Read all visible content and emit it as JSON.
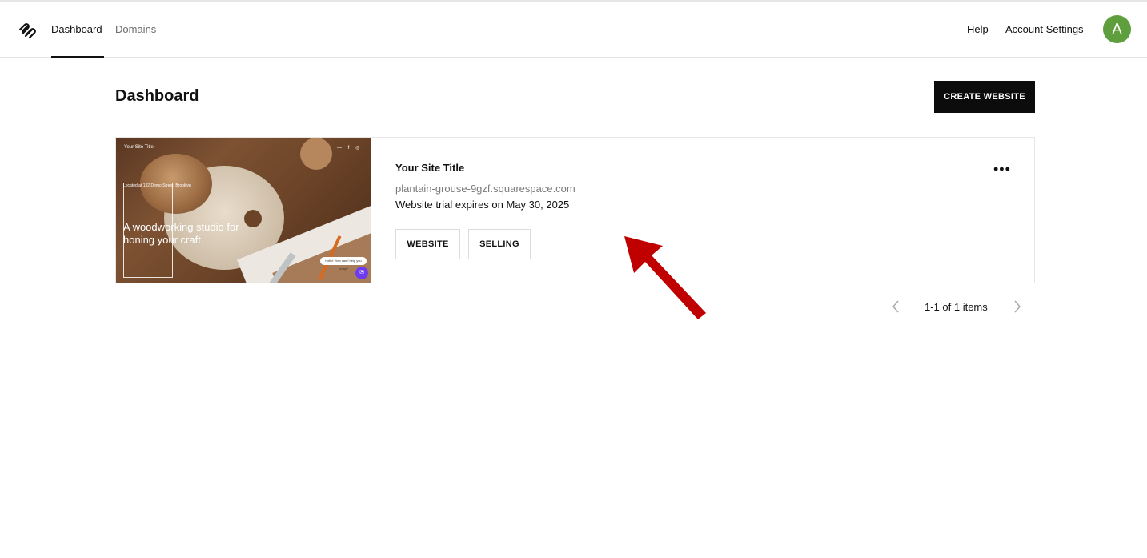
{
  "header": {
    "nav": [
      {
        "label": "Dashboard",
        "active": true
      },
      {
        "label": "Domains",
        "active": false
      }
    ],
    "help_label": "Help",
    "account_settings_label": "Account Settings",
    "avatar_initial": "A",
    "avatar_color": "#5e9e3c"
  },
  "page": {
    "title": "Dashboard",
    "create_button_label": "CREATE WEBSITE"
  },
  "site_card": {
    "thumbnail": {
      "site_title": "Your Site Title",
      "address": "Located at 132 Demo Street, Brooklyn",
      "headline": "A woodworking studio for honing your craft.",
      "chat_bubble": "Hello! How can I help you today?"
    },
    "title": "Your Site Title",
    "url": "plantain-grouse-9gzf.squarespace.com",
    "trial_status": "Website trial expires on May 30, 2025",
    "website_button_label": "WEBSITE",
    "selling_button_label": "SELLING",
    "more_label": "•••"
  },
  "pagination": {
    "text": "1-1 of 1 items"
  },
  "annotation": {
    "arrow_color": "#c00000"
  }
}
